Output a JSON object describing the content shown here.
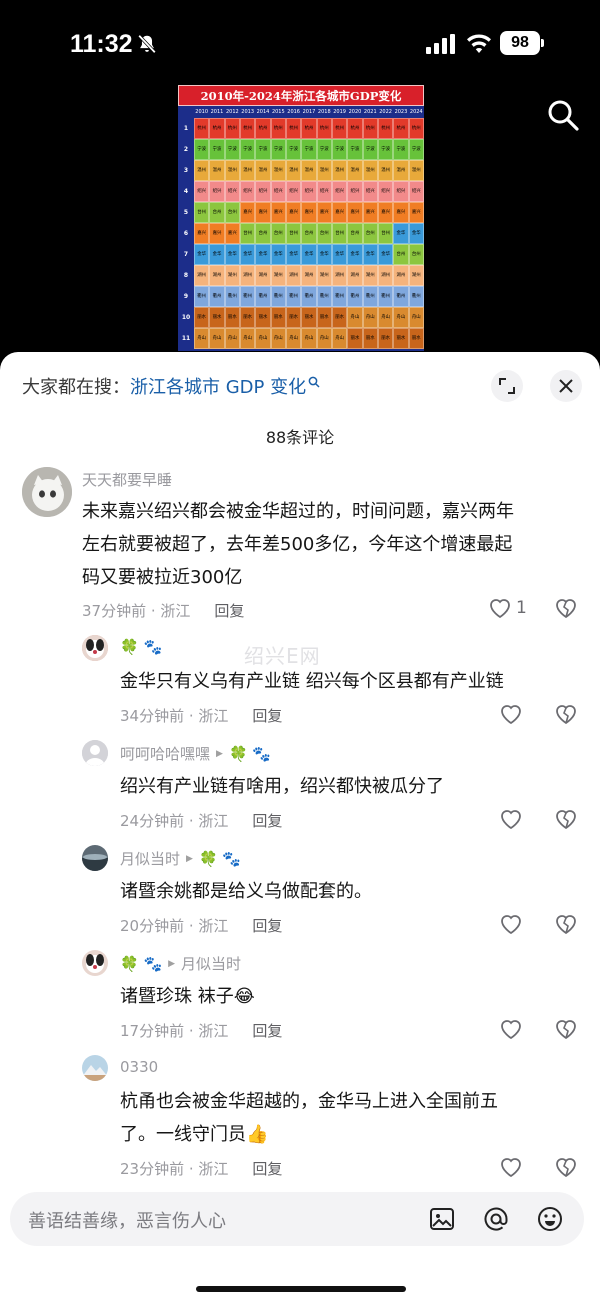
{
  "status_bar": {
    "time": "11:32",
    "battery": "98"
  },
  "gdp_image": {
    "title": "2010年-2024年浙江各城市GDP变化",
    "years": [
      "2010",
      "2011",
      "2012",
      "2013",
      "2014",
      "2015",
      "2016",
      "2017",
      "2018",
      "2019",
      "2020",
      "2021",
      "2022",
      "2023",
      "2024"
    ],
    "ranks": [
      "1",
      "2",
      "3",
      "4",
      "5",
      "6",
      "7",
      "8",
      "9",
      "10",
      "11"
    ],
    "rows": [
      [
        "杭州",
        "杭州",
        "杭州",
        "杭州",
        "杭州",
        "杭州",
        "杭州",
        "杭州",
        "杭州",
        "杭州",
        "杭州",
        "杭州",
        "杭州",
        "杭州",
        "杭州"
      ],
      [
        "宁波",
        "宁波",
        "宁波",
        "宁波",
        "宁波",
        "宁波",
        "宁波",
        "宁波",
        "宁波",
        "宁波",
        "宁波",
        "宁波",
        "宁波",
        "宁波",
        "宁波"
      ],
      [
        "温州",
        "温州",
        "温州",
        "温州",
        "温州",
        "温州",
        "温州",
        "温州",
        "温州",
        "温州",
        "温州",
        "温州",
        "温州",
        "温州",
        "温州"
      ],
      [
        "绍兴",
        "绍兴",
        "绍兴",
        "绍兴",
        "绍兴",
        "绍兴",
        "绍兴",
        "绍兴",
        "绍兴",
        "绍兴",
        "绍兴",
        "绍兴",
        "绍兴",
        "绍兴",
        "绍兴"
      ],
      [
        "台州",
        "台州",
        "台州",
        "嘉兴",
        "嘉兴",
        "嘉兴",
        "嘉兴",
        "嘉兴",
        "嘉兴",
        "嘉兴",
        "嘉兴",
        "嘉兴",
        "嘉兴",
        "嘉兴",
        "嘉兴"
      ],
      [
        "嘉兴",
        "嘉兴",
        "嘉兴",
        "台州",
        "台州",
        "台州",
        "台州",
        "台州",
        "台州",
        "台州",
        "台州",
        "台州",
        "台州",
        "金华",
        "金华"
      ],
      [
        "金华",
        "金华",
        "金华",
        "金华",
        "金华",
        "金华",
        "金华",
        "金华",
        "金华",
        "金华",
        "金华",
        "金华",
        "金华",
        "台州",
        "台州"
      ],
      [
        "湖州",
        "湖州",
        "湖州",
        "湖州",
        "湖州",
        "湖州",
        "湖州",
        "湖州",
        "湖州",
        "湖州",
        "湖州",
        "湖州",
        "湖州",
        "湖州",
        "湖州"
      ],
      [
        "衢州",
        "衢州",
        "衢州",
        "衢州",
        "衢州",
        "衢州",
        "衢州",
        "衢州",
        "衢州",
        "衢州",
        "衢州",
        "衢州",
        "衢州",
        "衢州",
        "衢州"
      ],
      [
        "丽水",
        "丽水",
        "丽水",
        "丽水",
        "丽水",
        "丽水",
        "丽水",
        "丽水",
        "丽水",
        "丽水",
        "舟山",
        "舟山",
        "舟山",
        "舟山",
        "舟山"
      ],
      [
        "舟山",
        "舟山",
        "舟山",
        "舟山",
        "舟山",
        "舟山",
        "舟山",
        "舟山",
        "舟山",
        "舟山",
        "丽水",
        "丽水",
        "丽水",
        "丽水",
        "丽水"
      ]
    ],
    "city_colors": {
      "杭州": "#e23a2a",
      "宁波": "#67c23a",
      "温州": "#e8a93a",
      "绍兴": "#f28a8a",
      "嘉兴": "#f07d24",
      "台州": "#8cc63f",
      "金华": "#3a9ad9",
      "湖州": "#f5b37c",
      "衢州": "#7fa7dd",
      "丽水": "#c8651b",
      "舟山": "#d98a2f"
    }
  },
  "search_suggestion": {
    "prefix": "大家都在搜：",
    "query": "浙江各城市 GDP 变化"
  },
  "comment_count": "88条评论",
  "watermark": "绍兴E网",
  "comments": [
    {
      "author": "天天都要早睡",
      "text_lines": [
        "未来嘉兴绍兴都会被金华超过的，时间问题，嘉兴两年",
        "左右就要被超了，去年差500多亿，今年这个增速最起",
        "码又要被拉近300亿"
      ],
      "time": "37分钟前 · 浙江",
      "reply": "回复",
      "likes": "1"
    },
    {
      "author": "🍀 🐾",
      "text_lines": [
        "金华只有义乌有产业链 绍兴每个区县都有产业链"
      ],
      "time": "34分钟前 · 浙江",
      "reply": "回复"
    },
    {
      "author": "呵呵哈哈嘿嘿",
      "reply_to": "🍀 🐾",
      "text_lines": [
        "绍兴有产业链有啥用，绍兴都快被瓜分了"
      ],
      "time": "24分钟前 · 浙江",
      "reply": "回复"
    },
    {
      "author": "月似当时",
      "reply_to": "🍀 🐾",
      "text_lines": [
        "诸暨余姚都是给义乌做配套的。"
      ],
      "time": "20分钟前 · 浙江",
      "reply": "回复"
    },
    {
      "author": "🍀 🐾",
      "reply_to": "月似当时",
      "text_lines": [
        "诸暨珍珠 袜子😂"
      ],
      "time": "17分钟前 · 浙江",
      "reply": "回复"
    },
    {
      "author": "0330",
      "text_lines": [
        "杭甬也会被金华超越的，金华马上进入全国前五",
        "了。一线守门员👍"
      ],
      "time": "23分钟前 · 浙江",
      "reply": "回复"
    }
  ],
  "input": {
    "placeholder": "善语结善缘，恶言伤人心"
  }
}
